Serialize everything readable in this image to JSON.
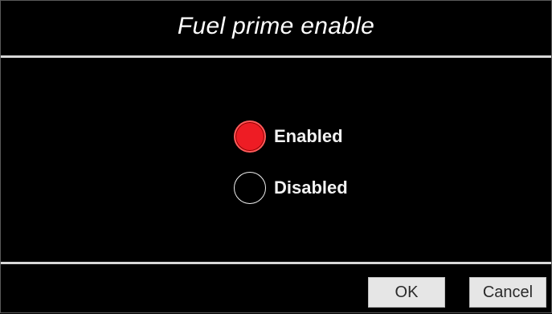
{
  "dialog": {
    "title": "Fuel prime enable"
  },
  "options": [
    {
      "label": "Enabled",
      "selected": true
    },
    {
      "label": "Disabled",
      "selected": false
    }
  ],
  "buttons": {
    "ok_label": "OK",
    "cancel_label": "Cancel"
  },
  "colors": {
    "background": "#000000",
    "selected_radio": "#ee1c24",
    "divider": "#d8d8d8",
    "button_bg": "#e6e6e6"
  }
}
